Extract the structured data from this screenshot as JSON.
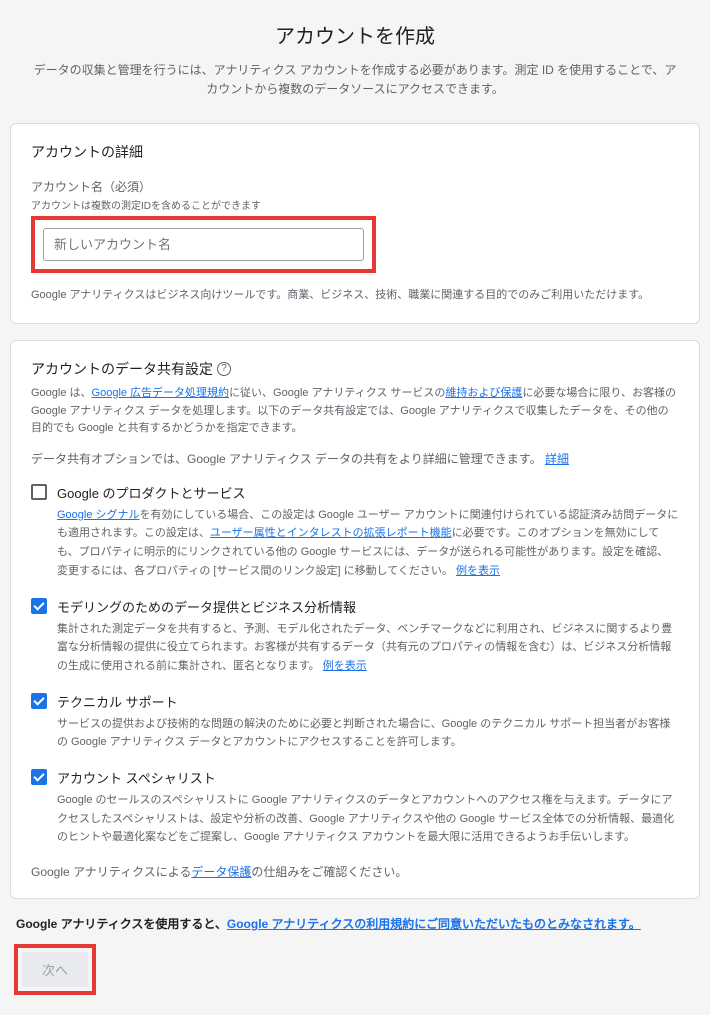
{
  "page": {
    "title": "アカウントを作成",
    "subtitle": "データの収集と管理を行うには、アナリティクス アカウントを作成する必要があります。測定 ID を使用することで、アカウントから複数のデータソースにアクセスできます。"
  },
  "details": {
    "card_title": "アカウントの詳細",
    "field_label": "アカウント名（必須）",
    "field_hint": "アカウントは複数の測定IDを含めることができます",
    "placeholder": "新しいアカウント名",
    "note": "Google アナリティクスはビジネス向けツールです。商業、ビジネス、技術、職業に関連する目的でのみご利用いただけます。"
  },
  "sharing": {
    "title": "アカウントのデータ共有設定",
    "desc_prefix": "Google は、",
    "desc_link1": "Google 広告データ処理規約",
    "desc_mid1": "に従い、Google アナリティクス サービスの",
    "desc_link2": "維持および保護",
    "desc_suffix": "に必要な場合に限り、お客様の Google アナリティクス データを処理します。以下のデータ共有設定では、Google アナリティクスで収集したデータを、その他の目的でも Google と共有するかどうかを指定できます。",
    "intro": "データ共有オプションでは、Google アナリティクス データの共有をより詳細に管理できます。",
    "intro_link": "詳細",
    "options": [
      {
        "checked": false,
        "title": "Google のプロダクトとサービス",
        "desc_prefix": "",
        "desc_link1": "Google シグナル",
        "desc_mid1": "を有効にしている場合、この設定は Google ユーザー アカウントに関連付けられている認証済み訪問データにも適用されます。この設定は、",
        "desc_link2": "ユーザー属性とインタレストの拡張レポート機能",
        "desc_mid2": "に必要です。このオプションを無効にしても、プロパティに明示的にリンクされている他の Google サービスには、データが送られる可能性があります。設定を確認、変更するには、各プロパティの [サービス間のリンク設定] に移動してください。",
        "desc_link3": "例を表示"
      },
      {
        "checked": true,
        "title": "モデリングのためのデータ提供とビジネス分析情報",
        "desc": "集計された測定データを共有すると、予測、モデル化されたデータ、ベンチマークなどに利用され、ビジネスに関するより豊富な分析情報の提供に役立てられます。お客様が共有するデータ（共有元のプロパティの情報を含む）は、ビジネス分析情報の生成に使用される前に集計され、匿名となります。",
        "desc_link": "例を表示"
      },
      {
        "checked": true,
        "title": "テクニカル サポート",
        "desc": "サービスの提供および技術的な問題の解決のために必要と判断された場合に、Google のテクニカル サポート担当者がお客様の Google アナリティクス データとアカウントにアクセスすることを許可します。"
      },
      {
        "checked": true,
        "title": "アカウント スペシャリスト",
        "desc": "Google のセールスのスペシャリストに Google アナリティクスのデータとアカウントへのアクセス権を与えます。データにアクセスしたスペシャリストは、設定や分析の改善、Google アナリティクスや他の Google サービス全体での分析情報、最適化のヒントや最適化案などをご提案し、Google アナリティクス アカウントを最大限に活用できるようお手伝いします。"
      }
    ],
    "footer_prefix": "Google アナリティクスによる",
    "footer_link": "データ保護",
    "footer_suffix": "の仕組みをご確認ください。"
  },
  "agreement": {
    "prefix": "Google アナリティクスを使用すると、",
    "link": "Google アナリティクスの利用規約にご同意いただいたものとみなされます。"
  },
  "next_button": "次へ"
}
